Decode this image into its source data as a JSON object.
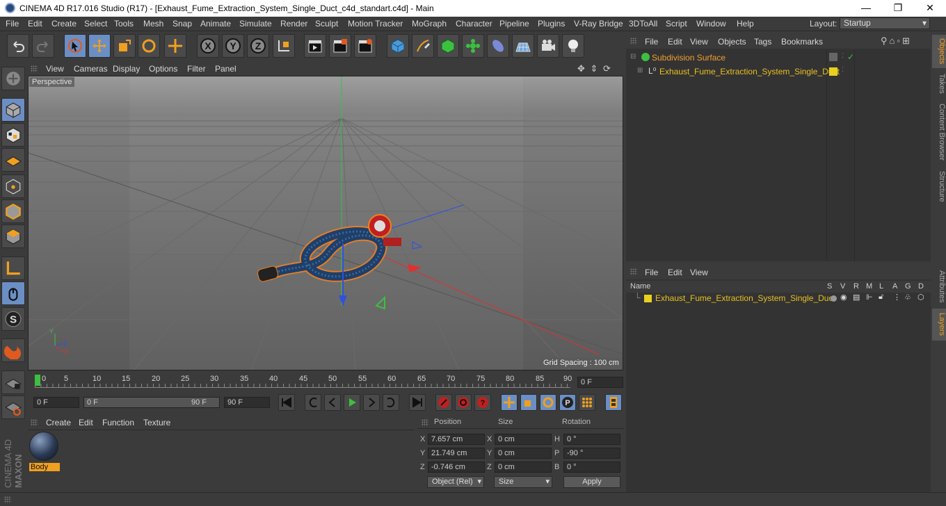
{
  "window": {
    "title": "CINEMA 4D R17.016 Studio (R17) - [Exhaust_Fume_Extraction_System_Single_Duct_c4d_standart.c4d] - Main",
    "min": "—",
    "max": "❐",
    "close": "✕"
  },
  "menu": [
    "File",
    "Edit",
    "Create",
    "Select",
    "Tools",
    "Mesh",
    "Snap",
    "Animate",
    "Simulate",
    "Render",
    "Sculpt",
    "Motion Tracker",
    "MoGraph",
    "Character",
    "Pipeline",
    "Plugins",
    "V-Ray Bridge",
    "3DToAll",
    "Script",
    "Window",
    "Help"
  ],
  "layout": {
    "label": "Layout:",
    "value": "Startup"
  },
  "viewport": {
    "menu": [
      "View",
      "Cameras",
      "Display",
      "Options",
      "Filter",
      "Panel"
    ],
    "label": "Perspective",
    "grid_spacing": "Grid Spacing : 100 cm"
  },
  "timeline": {
    "ticks": [
      "0",
      "5",
      "10",
      "15",
      "20",
      "25",
      "30",
      "35",
      "40",
      "45",
      "50",
      "55",
      "60",
      "65",
      "70",
      "75",
      "80",
      "85",
      "90"
    ],
    "current": "0 F"
  },
  "controls": {
    "start": "0 F",
    "range_start": "0 F",
    "range_end": "90 F",
    "end": "90 F"
  },
  "material": {
    "menu": [
      "Create",
      "Edit",
      "Function",
      "Texture"
    ],
    "name": "Body"
  },
  "coords": {
    "headers": [
      "Position",
      "Size",
      "Rotation"
    ],
    "rows": [
      {
        "axis": "X",
        "pos": "7.657 cm",
        "saxis": "X",
        "size": "0 cm",
        "raxis": "H",
        "rot": "0 °"
      },
      {
        "axis": "Y",
        "pos": "21.749 cm",
        "saxis": "Y",
        "size": "0 cm",
        "raxis": "P",
        "rot": "-90 °"
      },
      {
        "axis": "Z",
        "pos": "-0.746 cm",
        "saxis": "Z",
        "size": "0 cm",
        "raxis": "B",
        "rot": "0 °"
      }
    ],
    "mode": "Object (Rel)",
    "size_mode": "Size",
    "apply": "Apply"
  },
  "objects": {
    "menu": [
      "File",
      "Edit",
      "View",
      "Objects",
      "Tags",
      "Bookmarks"
    ],
    "items": [
      "Subdivision Surface",
      "Exhaust_Fume_Extraction_System_Single_Duct"
    ]
  },
  "layers": {
    "menu": [
      "File",
      "Edit",
      "View"
    ],
    "columns": [
      "Name",
      "S",
      "V",
      "R",
      "M",
      "L",
      "A",
      "G",
      "D"
    ],
    "items": [
      "Exhaust_Fume_Extraction_System_Single_Duct"
    ]
  },
  "sidetabs": [
    "Objects",
    "Takes",
    "Content Browser",
    "Structure",
    "Attributes",
    "Layers"
  ],
  "brand": [
    "MAXON",
    "CINEMA 4D"
  ]
}
